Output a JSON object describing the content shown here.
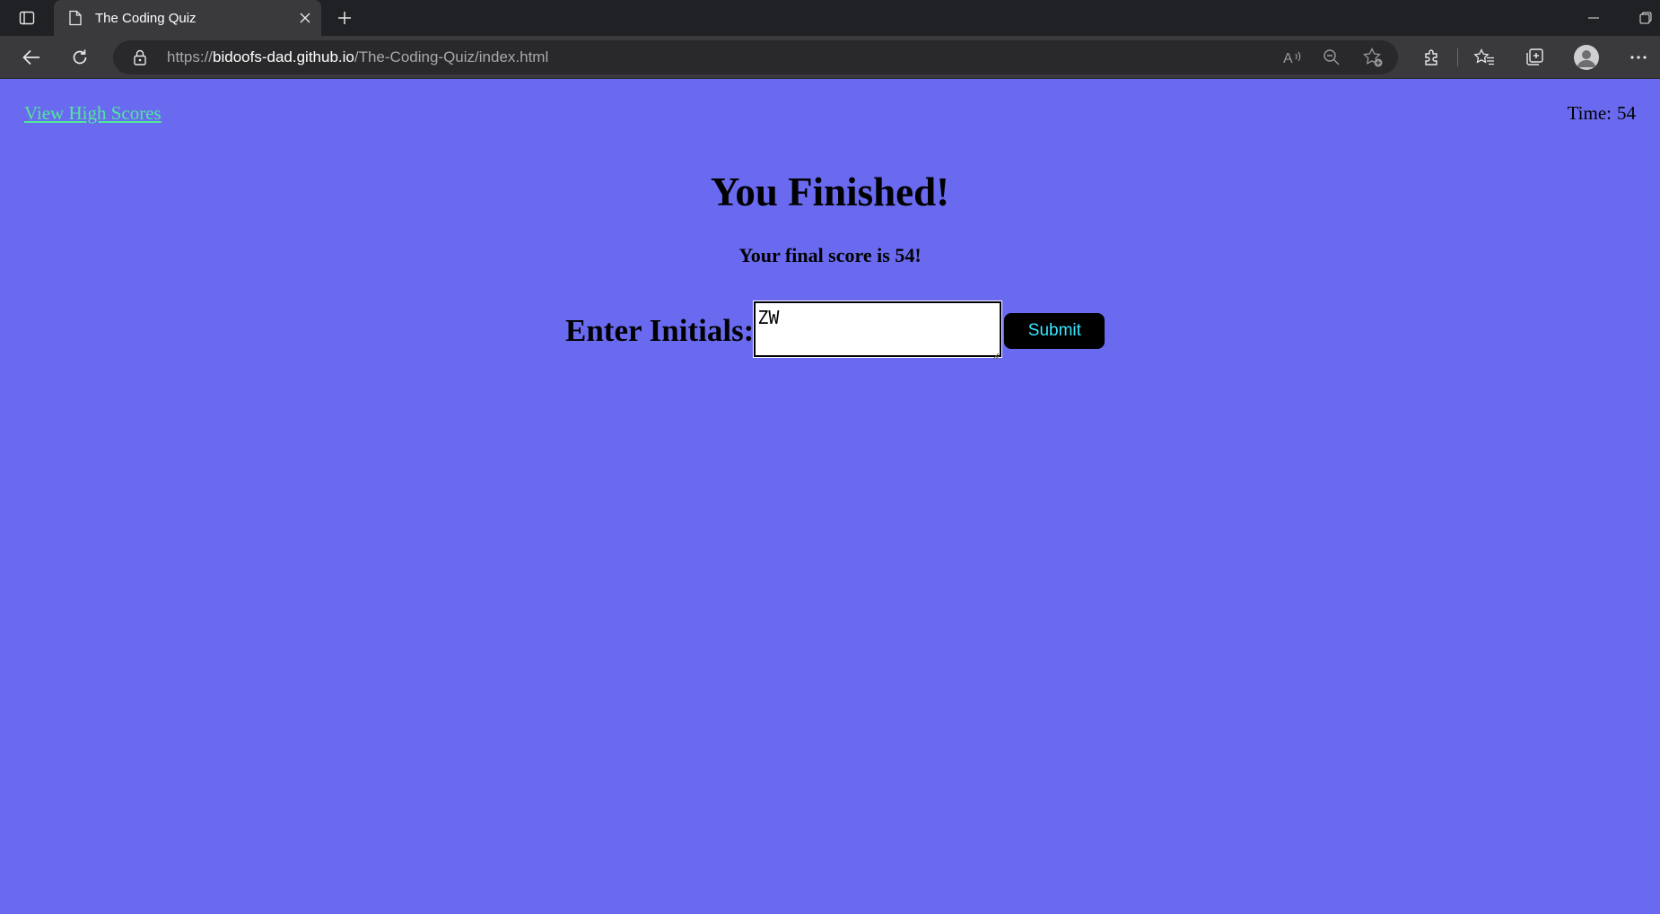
{
  "browser": {
    "tab_title": "The Coding Quiz",
    "url_prefix": "https://",
    "url_host": "bidoofs-dad.github.io",
    "url_path": "/The-Coding-Quiz/index.html"
  },
  "quiz": {
    "high_scores_link": "View High Scores",
    "timer_label": "Time:",
    "timer_value": "54",
    "heading": "You Finished!",
    "score_prefix": "Your final score is ",
    "score_value": "54",
    "score_suffix": "!",
    "initials_label": "Enter Initials:",
    "initials_value": "ZW",
    "submit_label": "Submit"
  },
  "colors": {
    "page_background": "#6a6af0",
    "link": "#4ee89a",
    "submit_text": "#39e6ff",
    "submit_background": "#000000"
  }
}
